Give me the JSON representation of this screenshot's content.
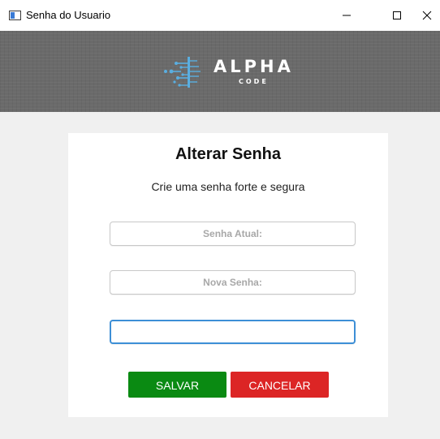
{
  "window": {
    "title": "Senha do Usuario"
  },
  "banner": {
    "logo_word": "ALPHA",
    "logo_sub": "CODE",
    "logo_color": "#5aaee0"
  },
  "form": {
    "title": "Alterar Senha",
    "subtitle": "Crie uma senha forte e segura",
    "current_password": {
      "placeholder": "Senha Atual:",
      "value": ""
    },
    "new_password": {
      "placeholder": "Nova Senha:",
      "value": ""
    },
    "confirm_password": {
      "placeholder": "",
      "value": ""
    },
    "save_label": "SALVAR",
    "cancel_label": "CANCELAR"
  },
  "colors": {
    "save": "#0a8a12",
    "cancel": "#dc2525",
    "focus_border": "#3d8fd6",
    "banner_bg": "#6a6a6a",
    "content_bg": "#f0f0f0"
  }
}
